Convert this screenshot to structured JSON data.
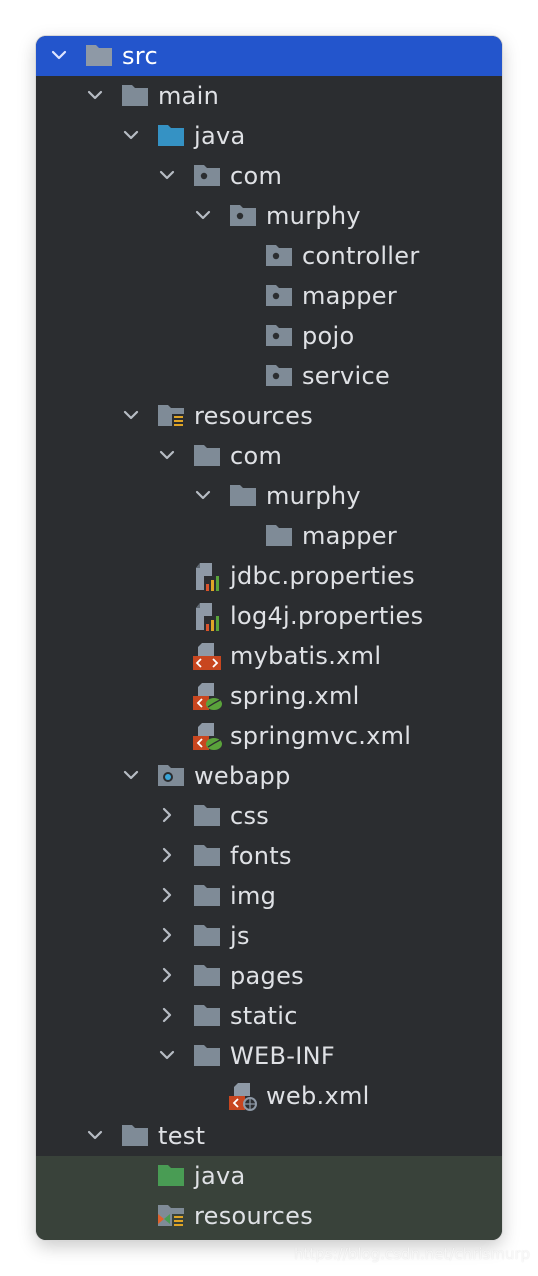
{
  "tree": {
    "nodes": [
      {
        "label": "src",
        "icon": "folder-icon",
        "expanded": true
      },
      {
        "label": "main",
        "icon": "folder-icon",
        "expanded": true
      },
      {
        "label": "java",
        "icon": "source-root-folder-icon",
        "expanded": true
      },
      {
        "label": "com",
        "icon": "package-icon",
        "expanded": true
      },
      {
        "label": "murphy",
        "icon": "package-icon",
        "expanded": true
      },
      {
        "label": "controller",
        "icon": "package-icon"
      },
      {
        "label": "mapper",
        "icon": "package-icon"
      },
      {
        "label": "pojo",
        "icon": "package-icon"
      },
      {
        "label": "service",
        "icon": "package-icon"
      },
      {
        "label": "resources",
        "icon": "resources-root-folder-icon",
        "expanded": true
      },
      {
        "label": "com",
        "icon": "folder-icon",
        "expanded": true
      },
      {
        "label": "murphy",
        "icon": "folder-icon",
        "expanded": true
      },
      {
        "label": "mapper",
        "icon": "folder-icon"
      },
      {
        "label": "jdbc.properties",
        "icon": "properties-file-icon"
      },
      {
        "label": "log4j.properties",
        "icon": "properties-file-icon"
      },
      {
        "label": "mybatis.xml",
        "icon": "xml-file-icon"
      },
      {
        "label": "spring.xml",
        "icon": "spring-xml-file-icon"
      },
      {
        "label": "springmvc.xml",
        "icon": "spring-xml-file-icon"
      },
      {
        "label": "webapp",
        "icon": "web-root-folder-icon",
        "expanded": true
      },
      {
        "label": "css",
        "icon": "folder-icon",
        "expanded": false
      },
      {
        "label": "fonts",
        "icon": "folder-icon",
        "expanded": false
      },
      {
        "label": "img",
        "icon": "folder-icon",
        "expanded": false
      },
      {
        "label": "js",
        "icon": "folder-icon",
        "expanded": false
      },
      {
        "label": "pages",
        "icon": "folder-icon",
        "expanded": false
      },
      {
        "label": "static",
        "icon": "folder-icon",
        "expanded": false
      },
      {
        "label": "WEB-INF",
        "icon": "folder-icon",
        "expanded": true
      },
      {
        "label": "web.xml",
        "icon": "web-xml-file-icon"
      },
      {
        "label": "test",
        "icon": "folder-icon",
        "expanded": true
      },
      {
        "label": "java",
        "icon": "test-source-root-folder-icon"
      },
      {
        "label": "resources",
        "icon": "test-resources-root-folder-icon"
      }
    ]
  },
  "watermark": "https://blog.csdn.net/chrismurp",
  "colors": {
    "panel": "#2b2d30",
    "selection": "#2355cc",
    "test_source_highlight": "#39423a",
    "text": "#dfe1e5",
    "folder": "#7f8b97",
    "source_root": "#3592c4",
    "test_root": "#499c54"
  }
}
